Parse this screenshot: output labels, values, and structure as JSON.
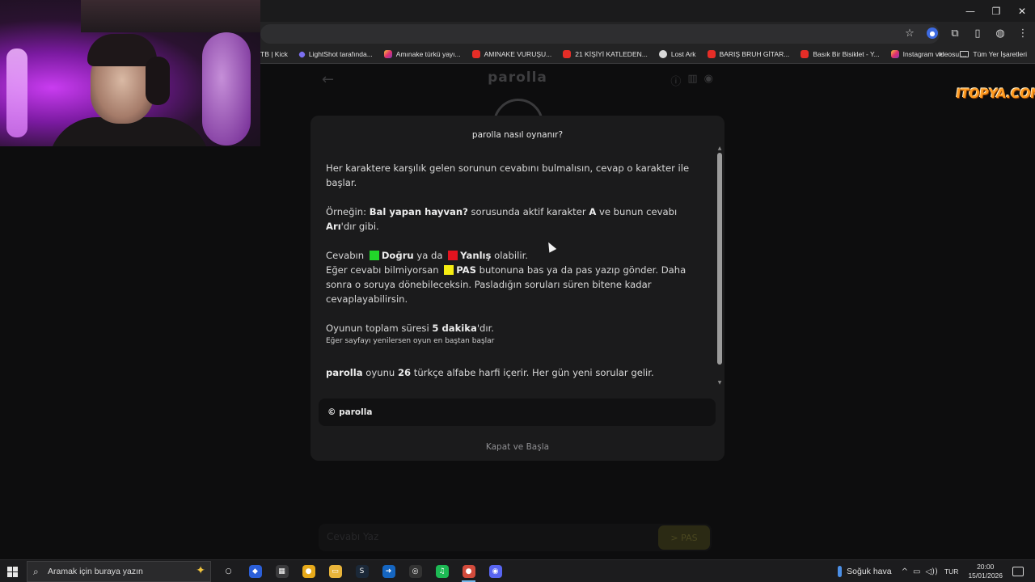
{
  "browser": {
    "bookmarks": [
      {
        "label": "TB | Kick",
        "icon": "kick-icon",
        "color": ""
      },
      {
        "label": "LightShot tarafında...",
        "icon": "lightshot-icon",
        "color": "ls"
      },
      {
        "label": "Amınake türkü yayı...",
        "icon": "instagram-icon",
        "color": "ig"
      },
      {
        "label": "AMINAKE VURUŞU...",
        "icon": "youtube-icon",
        "color": "yt"
      },
      {
        "label": "21 KİŞİYİ KATLEDEN...",
        "icon": "youtube-icon",
        "color": "yt"
      },
      {
        "label": "Lost Ark",
        "icon": "globe-icon",
        "color": "globe"
      },
      {
        "label": "BARIŞ BRUH GİTAR...",
        "icon": "youtube-icon",
        "color": "yt"
      },
      {
        "label": "Basık Bir Bisiklet - Y...",
        "icon": "youtube-icon",
        "color": "yt"
      },
      {
        "label": "Instagram videosu:...",
        "icon": "instagram-icon",
        "color": "ig"
      }
    ],
    "more_label": "»",
    "all_bookmarks_label": "Tüm Yer İşaretleri"
  },
  "app": {
    "title": "parolla",
    "answer_placeholder": "Cevabı Yaz",
    "answer_button": "> PAS"
  },
  "watermark": "ITOPYA.COM",
  "modal": {
    "title": "parolla nasıl oynanır?",
    "p1": "Her karaktere karşılık gelen sorunun cevabını bulmalısın, cevap o karakter ile başlar.",
    "p2": {
      "pre": "Örneğin: ",
      "question": "Bal yapan hayvan?",
      "mid": " sorusunda aktif karakter ",
      "letter": "A",
      "mid2": " ve bunun cevabı ",
      "answer": "Arı",
      "post": "'dır gibi."
    },
    "p3": {
      "pre": "Cevabın ",
      "correct": "Doğru",
      "mid": " ya da ",
      "wrong": "Yanlış",
      "post": " olabilir."
    },
    "p4": {
      "pre": "Eğer cevabı bilmiyorsan ",
      "pass": "PAS",
      "post": " butonuna bas ya da pas yazıp gönder. Daha sonra o soruya dönebileceksin. Pasladığın soruları süren bitene kadar cevaplayabilirsin."
    },
    "p5": {
      "pre": "Oyunun toplam süresi ",
      "duration": "5 dakika",
      "post": "'dır."
    },
    "p5_note": "Eğer sayfayı yenilersen oyun en baştan başlar",
    "p6": {
      "brand": "parolla",
      "mid": " oyunu ",
      "count": "26",
      "post": " türkçe alfabe harfi içerir. Her gün yeni sorular gelir."
    },
    "copyright": "© parolla",
    "close_label": "Kapat ve Başla",
    "colors": {
      "correct": "#22d62a",
      "wrong": "#e3131f",
      "pass": "#f5ec12"
    }
  },
  "taskbar": {
    "search_placeholder": "Aramak için buraya yazın",
    "weather": "Soğuk hava",
    "language": "TUR",
    "time": "20:00",
    "date": "15/01/2026",
    "apps": [
      {
        "name": "cortana",
        "glyph": "○",
        "color": "transparent"
      },
      {
        "name": "app-blue",
        "glyph": "◆",
        "color": "#2b5fd9"
      },
      {
        "name": "calculator",
        "glyph": "▦",
        "color": "#3a3a3c"
      },
      {
        "name": "chrome",
        "glyph": "●",
        "color": "#e6a91a"
      },
      {
        "name": "file-explorer",
        "glyph": "▭",
        "color": "#e8b43a"
      },
      {
        "name": "steam",
        "glyph": "S",
        "color": "#1b2838"
      },
      {
        "name": "app-arrow",
        "glyph": "➜",
        "color": "#1565c0"
      },
      {
        "name": "app-gauge",
        "glyph": "◎",
        "color": "#333"
      },
      {
        "name": "spotify",
        "glyph": "♫",
        "color": "#1db954"
      },
      {
        "name": "chrome-active",
        "glyph": "●",
        "color": "#d24b3c"
      },
      {
        "name": "discord",
        "glyph": "◉",
        "color": "#5865f2"
      }
    ]
  }
}
